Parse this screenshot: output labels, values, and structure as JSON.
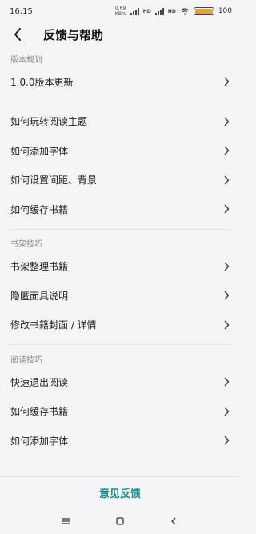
{
  "status_bar": {
    "time": "16:15",
    "net_speed": "0.69 KB/s",
    "hd1": "HD",
    "hd2": "HD",
    "battery_percent": 100,
    "battery_text": "100"
  },
  "header": {
    "title": "反馈与帮助"
  },
  "sections": [
    {
      "label": "版本规划",
      "items": [
        "1.0.0版本更新"
      ]
    },
    {
      "label": "",
      "items": [
        "如何玩转阅读主题",
        "如何添加字体",
        "如何设置间距、背景",
        "如何缓存书籍"
      ]
    },
    {
      "label": "书架技巧",
      "items": [
        "书架整理书籍",
        "隐匿面具说明",
        "修改书籍封面 / 详情"
      ]
    },
    {
      "label": "阅读技巧",
      "items": [
        "快速退出阅读",
        "如何缓存书籍",
        "如何添加字体"
      ]
    }
  ],
  "footer": {
    "feedback_label": "意见反馈"
  },
  "colors": {
    "accent": "#1a8a8a",
    "battery": "#e6a23c"
  }
}
